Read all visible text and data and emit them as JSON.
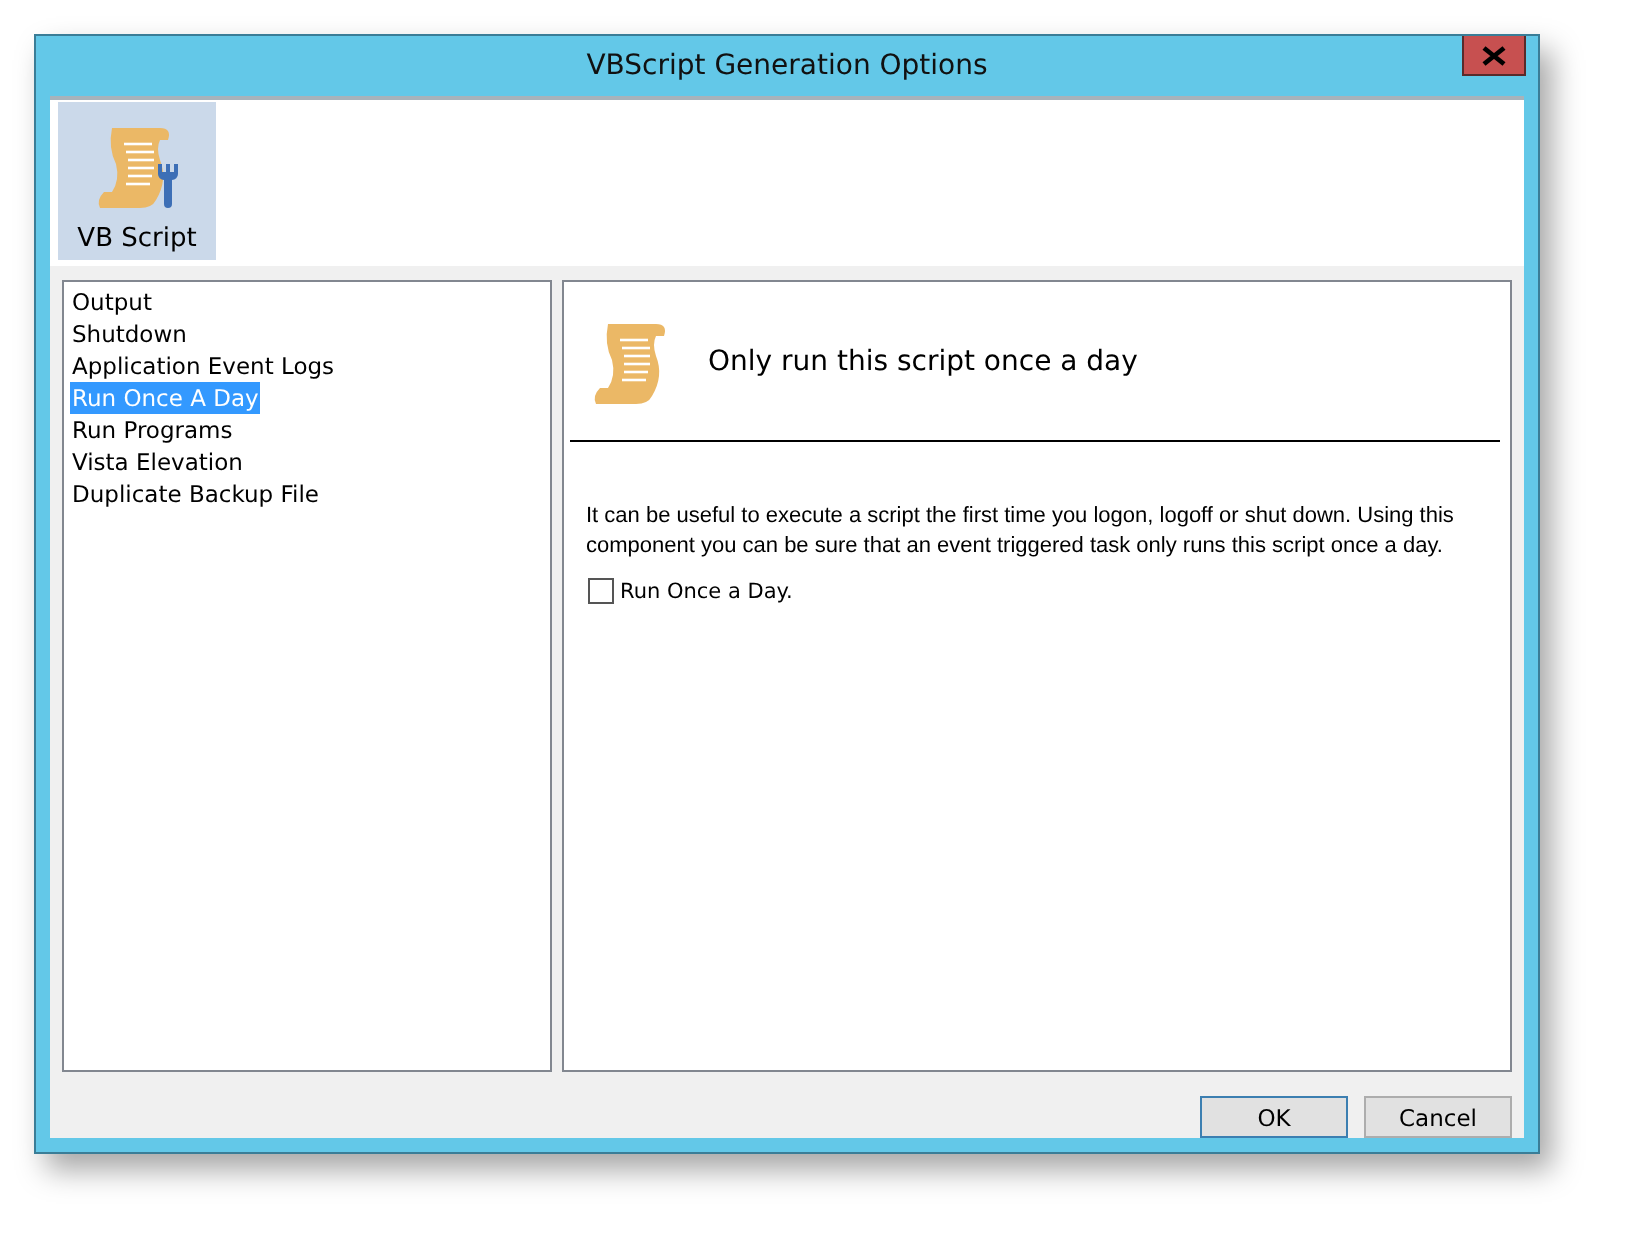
{
  "window": {
    "title": "VBScript Generation Options"
  },
  "toolbar": [
    {
      "label": "VB Script",
      "selected": true
    }
  ],
  "sidebar": {
    "items": [
      {
        "label": "Output",
        "selected": false
      },
      {
        "label": "Shutdown",
        "selected": false
      },
      {
        "label": "Application Event Logs",
        "selected": false
      },
      {
        "label": "Run Once A Day",
        "selected": true
      },
      {
        "label": "Run Programs",
        "selected": false
      },
      {
        "label": "Vista Elevation",
        "selected": false
      },
      {
        "label": "Duplicate Backup File",
        "selected": false
      }
    ]
  },
  "panel": {
    "heading": "Only run this script once a day",
    "description": "It can be useful to execute a script the first time you logon, logoff or shut down. Using this component you can be sure that an event triggered task only runs this script once a day.",
    "checkbox": {
      "label": "Run Once a Day.",
      "checked": false
    }
  },
  "buttons": [
    {
      "label": "OK",
      "default": true
    },
    {
      "label": "Cancel",
      "default": false
    }
  ]
}
